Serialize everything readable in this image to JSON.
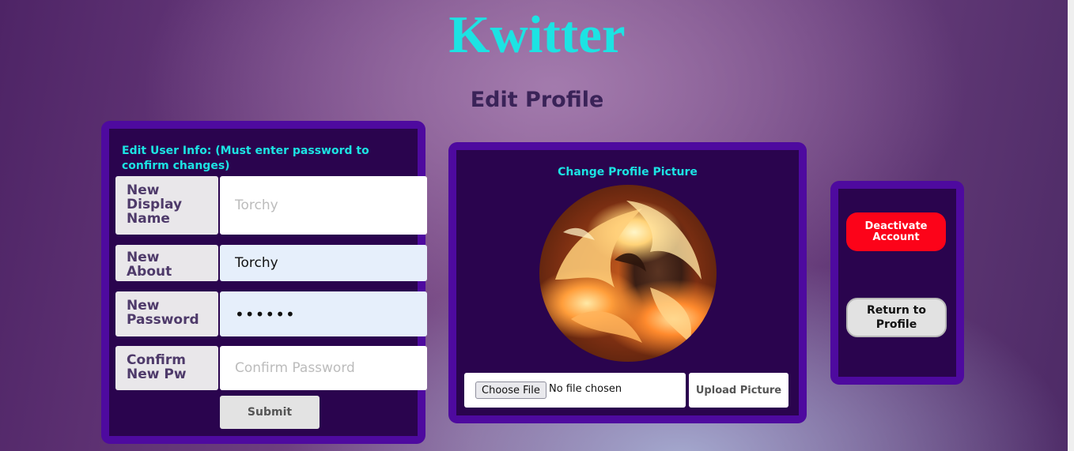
{
  "app": {
    "title": "Kwitter"
  },
  "page": {
    "heading": "Edit Profile"
  },
  "user_info": {
    "heading": "Edit User Info: (Must enter password to confirm changes)",
    "display_name": {
      "label": "New Display Name",
      "value": "",
      "placeholder": "Torchy"
    },
    "about": {
      "label": "New About",
      "value": "Torchy",
      "placeholder": ""
    },
    "password": {
      "label": "New Password",
      "value": "••••••",
      "placeholder": ""
    },
    "confirm": {
      "label": "Confirm New Pw",
      "value": "",
      "placeholder": "Confirm Password"
    },
    "submit_label": "Submit"
  },
  "picture": {
    "heading": "Change Profile Picture",
    "choose_label": "Choose File",
    "file_status": "No file chosen",
    "upload_label": "Upload Picture"
  },
  "account": {
    "deactivate_label": "Deactivate Account",
    "return_label": "Return to Profile"
  },
  "colors": {
    "title": "#1ce3e3",
    "panel_border": "#4e0a9f",
    "panel_fill": "#2a044e",
    "danger": "#fc0319"
  }
}
